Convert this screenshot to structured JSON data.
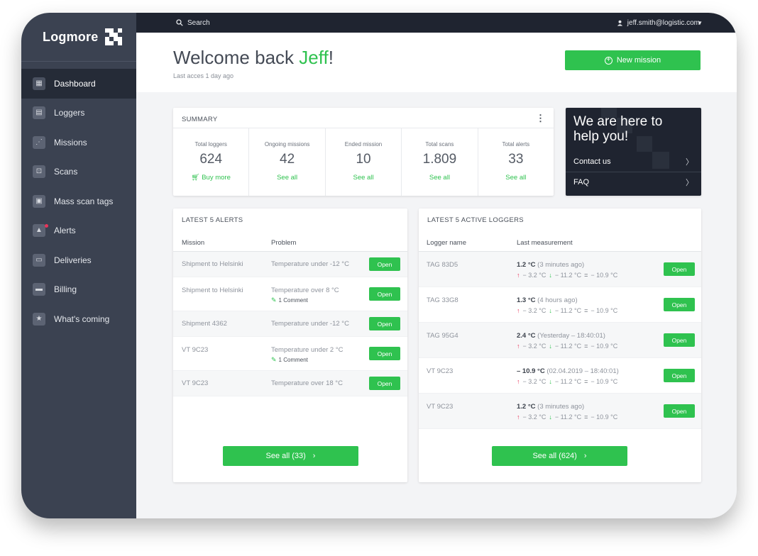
{
  "brand": {
    "name": "Logmore"
  },
  "sidebar": {
    "items": [
      {
        "label": "Dashboard",
        "icon": "grid-icon",
        "active": true
      },
      {
        "label": "Loggers",
        "icon": "logger-icon",
        "active": false
      },
      {
        "label": "Missions",
        "icon": "share-icon",
        "active": false
      },
      {
        "label": "Scans",
        "icon": "scan-icon",
        "active": false
      },
      {
        "label": "Mass scan tags",
        "icon": "tag-icon",
        "active": false
      },
      {
        "label": "Alerts",
        "icon": "warning-icon",
        "active": false,
        "has_badge": true
      },
      {
        "label": "Deliveries",
        "icon": "truck-icon",
        "active": false
      },
      {
        "label": "Billing",
        "icon": "card-icon",
        "active": false
      },
      {
        "label": "What's coming",
        "icon": "star-icon",
        "active": false
      }
    ]
  },
  "topbar": {
    "search_label": "Search",
    "user_email": "jeff.smith@logistic.com"
  },
  "header": {
    "welcome_prefix": "Welcome back ",
    "user_name": "Jeff",
    "welcome_suffix": "!",
    "last_access": "Last acces 1 day ago",
    "new_mission_label": "New mission"
  },
  "summary": {
    "title": "SUMMARY",
    "stats": [
      {
        "label": "Total loggers",
        "value": "624",
        "link": "Buy more"
      },
      {
        "label": "Ongoing missions",
        "value": "42",
        "link": "See all"
      },
      {
        "label": "Ended mission",
        "value": "10",
        "link": "See all"
      },
      {
        "label": "Total scans",
        "value": "1.809",
        "link": "See all"
      },
      {
        "label": "Total alerts",
        "value": "33",
        "link": "See all"
      }
    ]
  },
  "help": {
    "title": "We are here to help you!",
    "contact_label": "Contact us",
    "faq_label": "FAQ"
  },
  "alerts": {
    "title": "LATEST 5 ALERTS",
    "col_mission": "Mission",
    "col_problem": "Problem",
    "rows": [
      {
        "mission": "Shipment to Helsinki",
        "problem": "Temperature under -12 °C",
        "comment": "",
        "action": "Open"
      },
      {
        "mission": "Shipment to Helsinki",
        "problem": "Temperature over 8 °C",
        "comment": "1 Comment",
        "action": "Open"
      },
      {
        "mission": "Shipment 4362",
        "problem": "Temperature under -12 °C",
        "comment": "",
        "action": "Open"
      },
      {
        "mission": "VT 9C23",
        "problem": "Temperature under 2 °C",
        "comment": "1 Comment",
        "action": "Open"
      },
      {
        "mission": "VT 9C23",
        "problem": "Temperature over 18 °C",
        "comment": "",
        "action": "Open"
      }
    ],
    "see_all_label": "See all (33)"
  },
  "loggers": {
    "title": "LATEST 5 ACTIVE LOGGERS",
    "col_name": "Logger name",
    "col_measurement": "Last measurement",
    "rows": [
      {
        "name": "TAG 83D5",
        "value": "1.2 °C",
        "time": "(3 minutes ago)",
        "max": "− 3.2 °C",
        "min": "− 11.2 °C",
        "avg": "− 10.9 °C",
        "action": "Open"
      },
      {
        "name": "TAG 33G8",
        "value": "1.3 °C",
        "time": "(4 hours ago)",
        "max": "− 3.2 °C",
        "min": "− 11.2 °C",
        "avg": "− 10.9 °C",
        "action": "Open"
      },
      {
        "name": "TAG 95G4",
        "value": "2.4 °C",
        "time": "(Yesterday – 18:40:01)",
        "max": "− 3.2 °C",
        "min": "− 11.2 °C",
        "avg": "− 10.9 °C",
        "action": "Open"
      },
      {
        "name": "VT 9C23",
        "value": "– 10.9 °C",
        "time": "(02.04.2019 – 18:40:01)",
        "max": "− 3.2 °C",
        "min": "− 11.2 °C",
        "avg": "− 10.9 °C",
        "action": "Open"
      },
      {
        "name": "VT 9C23",
        "value": "1.2 °C",
        "time": "(3 minutes ago)",
        "max": "− 3.2 °C",
        "min": "− 11.2 °C",
        "avg": "− 10.9 °C",
        "action": "Open"
      }
    ],
    "see_all_label": "See all (624)"
  },
  "colors": {
    "accent": "#2fc24f",
    "sidebar": "#3b4251",
    "topbar": "#1f2430",
    "alert": "#e8345a"
  }
}
